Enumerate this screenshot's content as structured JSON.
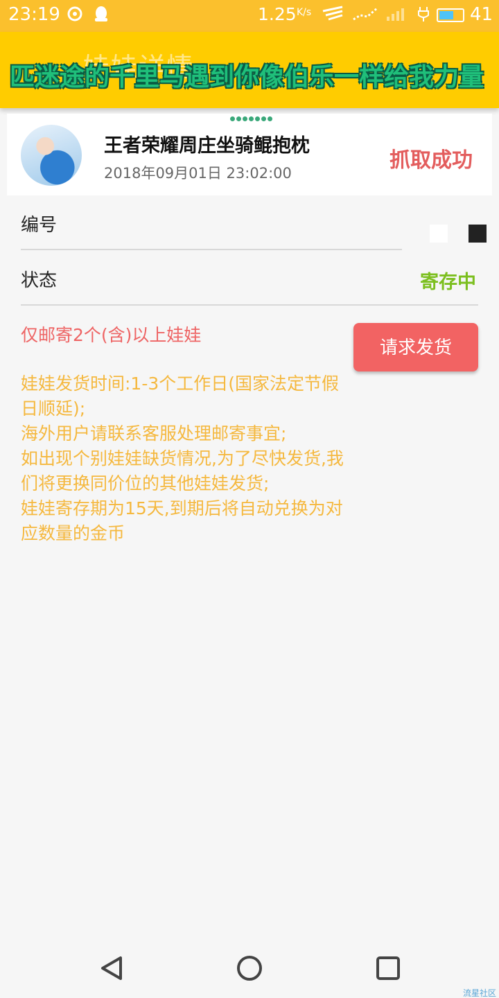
{
  "status_bar": {
    "time": "23:19",
    "speed": "1.25",
    "speed_unit": "K/s",
    "battery": "41",
    "icons": [
      "weibo-icon",
      "qq-icon",
      "signal-icon",
      "wifi-icon",
      "battery-icon"
    ]
  },
  "header": {
    "title": "娃娃详情",
    "marquee": "匹迷途的千里马遇到你像伯乐一样给我力量"
  },
  "product": {
    "name": "王者荣耀周庄坐骑鲲抱枕",
    "date": "2018年09月01日 23:02:00",
    "status": "抓取成功"
  },
  "details": {
    "id_label": "编号",
    "state_label": "状态",
    "state_value": "寄存中"
  },
  "shipping": {
    "notice": "仅邮寄2个(含)以上娃娃",
    "button_label": "请求发货",
    "info_lines": [
      "娃娃发货时间:1-3个工作日(国家法定节假日顺延);",
      "海外用户请联系客服处理邮寄事宜;",
      "如出现个别娃娃缺货情况,为了尽快发货,我们将更换同价位的其他娃娃发货;",
      "娃娃寄存期为15天,到期后将自动兑换为对应数量的金币"
    ]
  },
  "watermark": "流星社区",
  "colors": {
    "header_bg": "#ffcc00",
    "status_red": "#e35d5d",
    "state_green": "#7cbf1f",
    "button_red": "#f26363",
    "info_orange": "#f5b83e"
  }
}
